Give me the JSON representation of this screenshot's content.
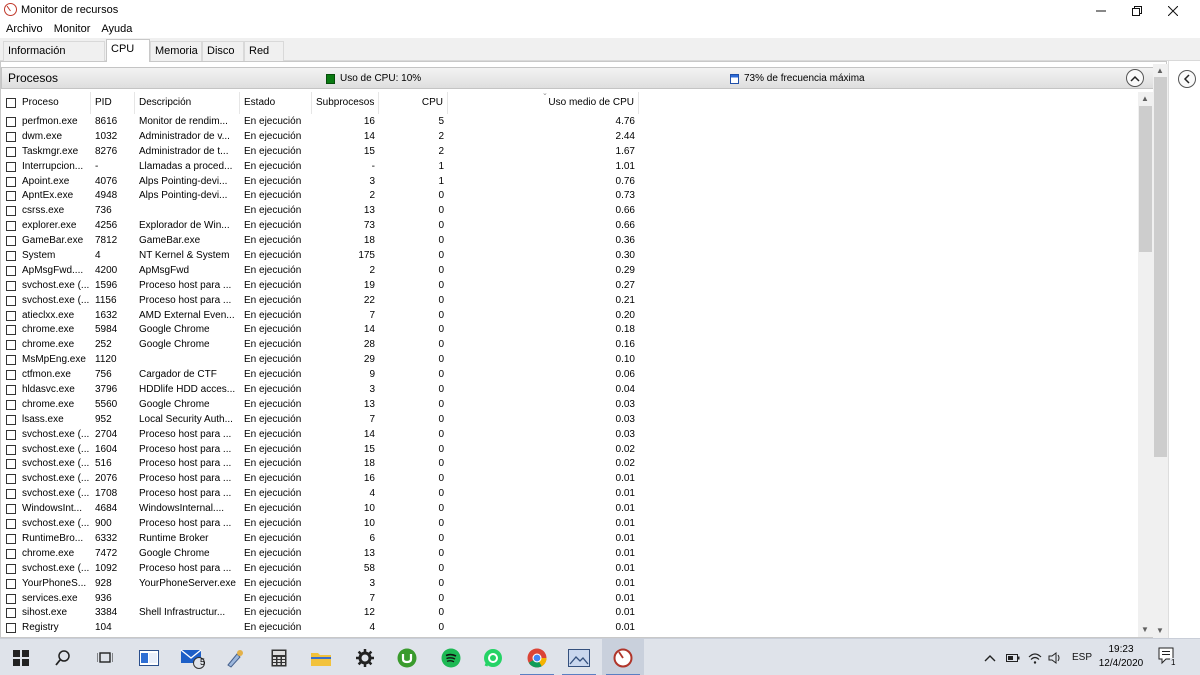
{
  "window": {
    "title": "Monitor de recursos"
  },
  "menu": [
    "Archivo",
    "Monitor",
    "Ayuda"
  ],
  "tabs": [
    {
      "label": "Información general",
      "active": false
    },
    {
      "label": "CPU",
      "active": true
    },
    {
      "label": "Memoria",
      "active": false
    },
    {
      "label": "Disco",
      "active": false
    },
    {
      "label": "Red",
      "active": false
    }
  ],
  "panel": {
    "title": "Procesos",
    "cpu_usage_label": "Uso de CPU: 10%",
    "freq_label": "73% de frecuencia máxima"
  },
  "columns": {
    "process": "Proceso",
    "pid": "PID",
    "description": "Descripción",
    "status": "Estado",
    "threads": "Subprocesos",
    "cpu": "CPU",
    "avg_cpu": "Uso medio de CPU"
  },
  "rows": [
    [
      "perfmon.exe",
      "8616",
      "Monitor de rendim...",
      "En ejecución",
      "16",
      "5",
      "4.76"
    ],
    [
      "dwm.exe",
      "1032",
      "Administrador de v...",
      "En ejecución",
      "14",
      "2",
      "2.44"
    ],
    [
      "Taskmgr.exe",
      "8276",
      "Administrador de t...",
      "En ejecución",
      "15",
      "2",
      "1.67"
    ],
    [
      "Interrupcion...",
      "-",
      "Llamadas a proced...",
      "En ejecución",
      "-",
      "1",
      "1.01"
    ],
    [
      "Apoint.exe",
      "4076",
      "Alps Pointing-devi...",
      "En ejecución",
      "3",
      "1",
      "0.76"
    ],
    [
      "ApntEx.exe",
      "4948",
      "Alps Pointing-devi...",
      "En ejecución",
      "2",
      "0",
      "0.73"
    ],
    [
      "csrss.exe",
      "736",
      "",
      "En ejecución",
      "13",
      "0",
      "0.66"
    ],
    [
      "explorer.exe",
      "4256",
      "Explorador de Win...",
      "En ejecución",
      "73",
      "0",
      "0.66"
    ],
    [
      "GameBar.exe",
      "7812",
      "GameBar.exe",
      "En ejecución",
      "18",
      "0",
      "0.36"
    ],
    [
      "System",
      "4",
      "NT Kernel & System",
      "En ejecución",
      "175",
      "0",
      "0.30"
    ],
    [
      "ApMsgFwd....",
      "4200",
      "ApMsgFwd",
      "En ejecución",
      "2",
      "0",
      "0.29"
    ],
    [
      "svchost.exe (...",
      "1596",
      "Proceso host para ...",
      "En ejecución",
      "19",
      "0",
      "0.27"
    ],
    [
      "svchost.exe (...",
      "1156",
      "Proceso host para ...",
      "En ejecución",
      "22",
      "0",
      "0.21"
    ],
    [
      "atieclxx.exe",
      "1632",
      "AMD External Even...",
      "En ejecución",
      "7",
      "0",
      "0.20"
    ],
    [
      "chrome.exe",
      "5984",
      "Google Chrome",
      "En ejecución",
      "14",
      "0",
      "0.18"
    ],
    [
      "chrome.exe",
      "252",
      "Google Chrome",
      "En ejecución",
      "28",
      "0",
      "0.16"
    ],
    [
      "MsMpEng.exe",
      "1120",
      "",
      "En ejecución",
      "29",
      "0",
      "0.10"
    ],
    [
      "ctfmon.exe",
      "756",
      "Cargador de CTF",
      "En ejecución",
      "9",
      "0",
      "0.06"
    ],
    [
      "hldasvc.exe",
      "3796",
      "HDDlife HDD acces...",
      "En ejecución",
      "3",
      "0",
      "0.04"
    ],
    [
      "chrome.exe",
      "5560",
      "Google Chrome",
      "En ejecución",
      "13",
      "0",
      "0.03"
    ],
    [
      "lsass.exe",
      "952",
      "Local Security Auth...",
      "En ejecución",
      "7",
      "0",
      "0.03"
    ],
    [
      "svchost.exe (...",
      "2704",
      "Proceso host para ...",
      "En ejecución",
      "14",
      "0",
      "0.03"
    ],
    [
      "svchost.exe (...",
      "1604",
      "Proceso host para ...",
      "En ejecución",
      "15",
      "0",
      "0.02"
    ],
    [
      "svchost.exe (...",
      "516",
      "Proceso host para ...",
      "En ejecución",
      "18",
      "0",
      "0.02"
    ],
    [
      "svchost.exe (...",
      "2076",
      "Proceso host para ...",
      "En ejecución",
      "16",
      "0",
      "0.01"
    ],
    [
      "svchost.exe (...",
      "1708",
      "Proceso host para ...",
      "En ejecución",
      "4",
      "0",
      "0.01"
    ],
    [
      "WindowsInt...",
      "4684",
      "WindowsInternal....",
      "En ejecución",
      "10",
      "0",
      "0.01"
    ],
    [
      "svchost.exe (...",
      "900",
      "Proceso host para ...",
      "En ejecución",
      "10",
      "0",
      "0.01"
    ],
    [
      "RuntimeBro...",
      "6332",
      "Runtime Broker",
      "En ejecución",
      "6",
      "0",
      "0.01"
    ],
    [
      "chrome.exe",
      "7472",
      "Google Chrome",
      "En ejecución",
      "13",
      "0",
      "0.01"
    ],
    [
      "svchost.exe (...",
      "1092",
      "Proceso host para ...",
      "En ejecución",
      "58",
      "0",
      "0.01"
    ],
    [
      "YourPhoneS...",
      "928",
      "YourPhoneServer.exe",
      "En ejecución",
      "3",
      "0",
      "0.01"
    ],
    [
      "services.exe",
      "936",
      "",
      "En ejecución",
      "7",
      "0",
      "0.01"
    ],
    [
      "sihost.exe",
      "3384",
      "Shell Infrastructur...",
      "En ejecución",
      "12",
      "0",
      "0.01"
    ],
    [
      "Registry",
      "104",
      "",
      "En ejecución",
      "4",
      "0",
      "0.01"
    ]
  ],
  "taskbar": {
    "mail_badge": "5",
    "language": "ESP",
    "time": "19:23",
    "date": "12/4/2020",
    "notification_count": "1",
    "colors": {
      "accent": "#5a7fc2",
      "taskbar_bg": "#dfe3ea"
    }
  }
}
